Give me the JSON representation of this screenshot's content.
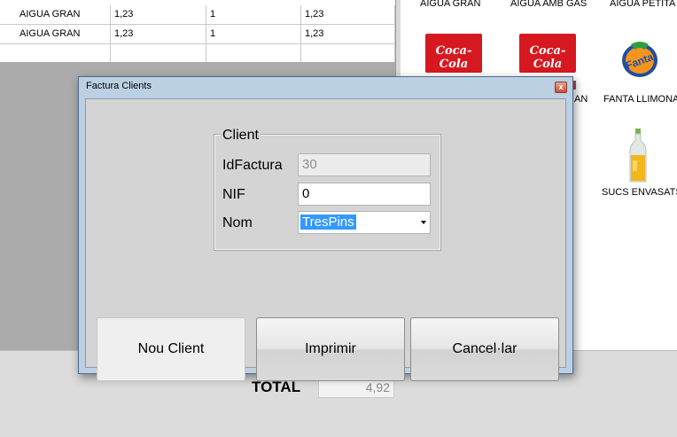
{
  "grid": {
    "rows": [
      [
        "AIGUA GRAN",
        "1,23",
        "1",
        "1,23"
      ],
      [
        "AIGUA GRAN",
        "1,23",
        "1",
        "1,23"
      ],
      [
        "",
        "",
        "",
        ""
      ]
    ]
  },
  "products": {
    "labels": [
      "AIGUA GRAN",
      "AIGUA AMB GAS",
      "AIGUA PETITA",
      "AN",
      "FANTA LLIMONA",
      "SUCS ENVASATS"
    ],
    "brand_text": [
      "Coca-Cola",
      "Coca-Cola",
      "Fanta"
    ]
  },
  "footer": {
    "total_label": "TOTAL",
    "total_value": "4,92"
  },
  "dialog": {
    "title": "Factura Clients",
    "close_glyph": "x",
    "group_title": "Client",
    "fields": {
      "idfactura_label": "IdFactura",
      "idfactura_value": "30",
      "nif_label": "NIF",
      "nif_value": "0",
      "nom_label": "Nom",
      "nom_value": "TresPins"
    },
    "buttons": {
      "new_client": "Nou Client",
      "print": "Imprimir",
      "cancel": "Cancel·lar"
    }
  },
  "colors": {
    "dialog_border": "#bcd0e3",
    "selection": "#3399ff",
    "coke_red": "#d61921"
  }
}
